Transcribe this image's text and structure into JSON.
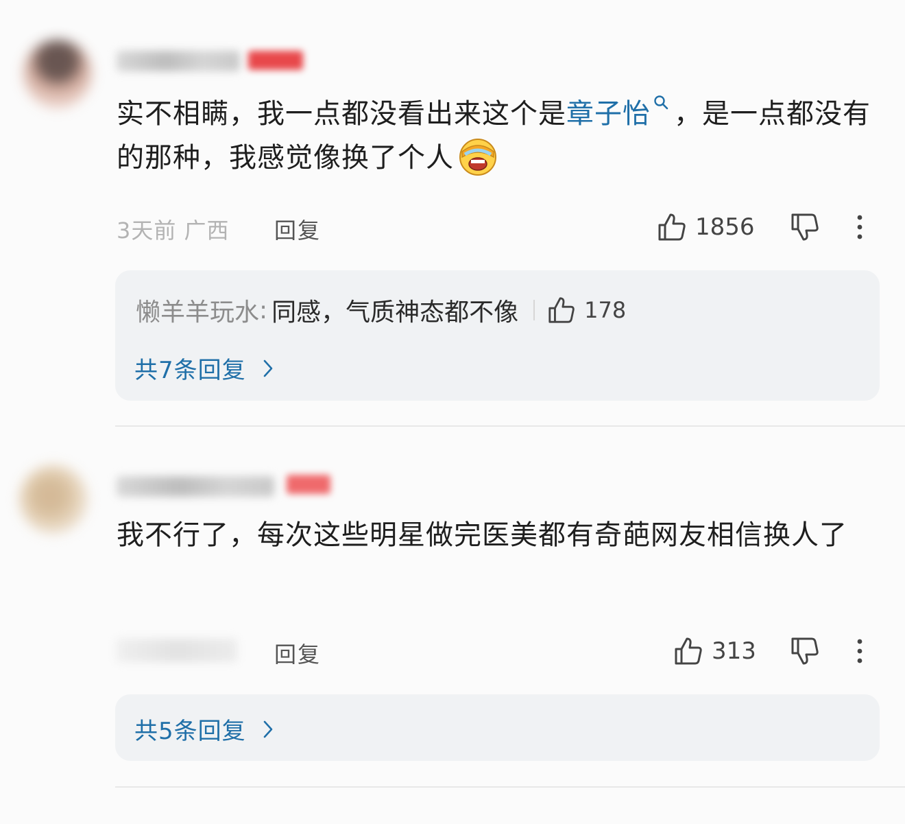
{
  "comments": [
    {
      "body_before": "实不相瞒，我一点都没看出来这个是",
      "topic_link": "章子怡",
      "body_after": "，是一点都没有的那种，我感觉像换了个人",
      "emoji": "laughing-crying-emoji",
      "time": "3天前",
      "location": "广西",
      "reply_label": "回复",
      "likes": "1856",
      "sub_replies": [
        {
          "user": "懒羊羊玩水",
          "colon": ":",
          "text": "同感，气质神态都不像",
          "likes": "178"
        }
      ],
      "more_replies_label": "共7条回复"
    },
    {
      "body": "我不行了，每次这些明星做完医美都有奇葩网友相信换人了",
      "reply_label": "回复",
      "likes": "313",
      "more_replies_label": "共5条回复"
    }
  ],
  "colors": {
    "link": "#1f6fa8",
    "badge": "#e8484b",
    "reply_box": "#f0f2f4",
    "background": "#fbfbfb"
  },
  "icons": [
    "thumbs-up-icon",
    "thumbs-down-icon",
    "more-vertical-icon",
    "search-icon",
    "chevron-right-icon"
  ]
}
